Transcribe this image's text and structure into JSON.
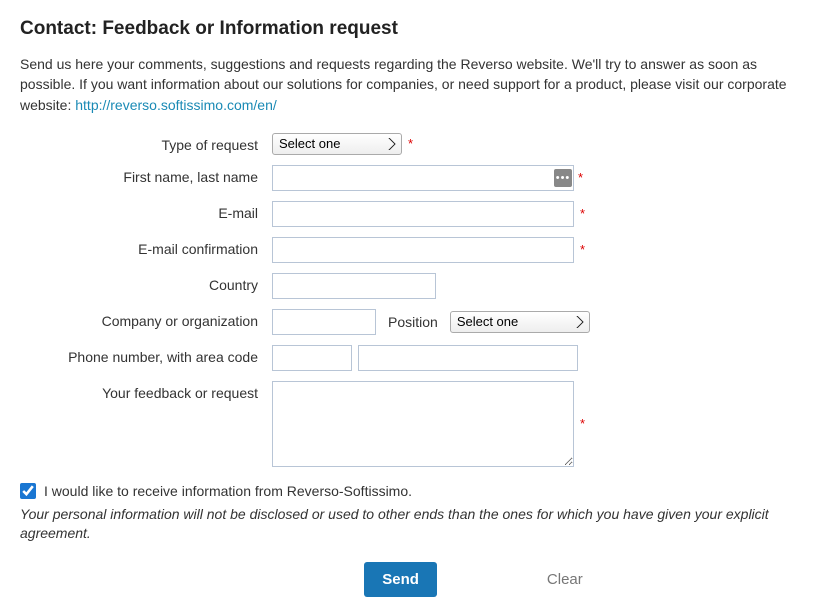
{
  "title": "Contact: Feedback or Information request",
  "intro_text": "Send us here your comments, suggestions and requests regarding the Reverso website. We'll try to answer as soon as possible. If you want information about our solutions for companies, or need support for a product, please visit our corporate website: ",
  "intro_link": "http://reverso.softissimo.com/en/",
  "labels": {
    "type": "Type of request",
    "name": "First name, last name",
    "email": "E-mail",
    "email_conf": "E-mail confirmation",
    "country": "Country",
    "company": "Company or organization",
    "position": "Position",
    "phone": "Phone number, with area code",
    "feedback": "Your feedback or request"
  },
  "selects": {
    "type_placeholder": "Select one",
    "position_placeholder": "Select one"
  },
  "values": {
    "name": "",
    "email": "",
    "email_conf": "",
    "country": "",
    "company": "",
    "phone1": "",
    "phone2": "",
    "feedback": ""
  },
  "opt_in_label": "I would like to receive information from Reverso-Softissimo.",
  "opt_in_checked": true,
  "disclaimer": "Your personal information will not be disclosed or used to other ends than the ones for which you have given your explicit agreement.",
  "buttons": {
    "send": "Send",
    "clear": "Clear"
  },
  "required_marker": "*"
}
